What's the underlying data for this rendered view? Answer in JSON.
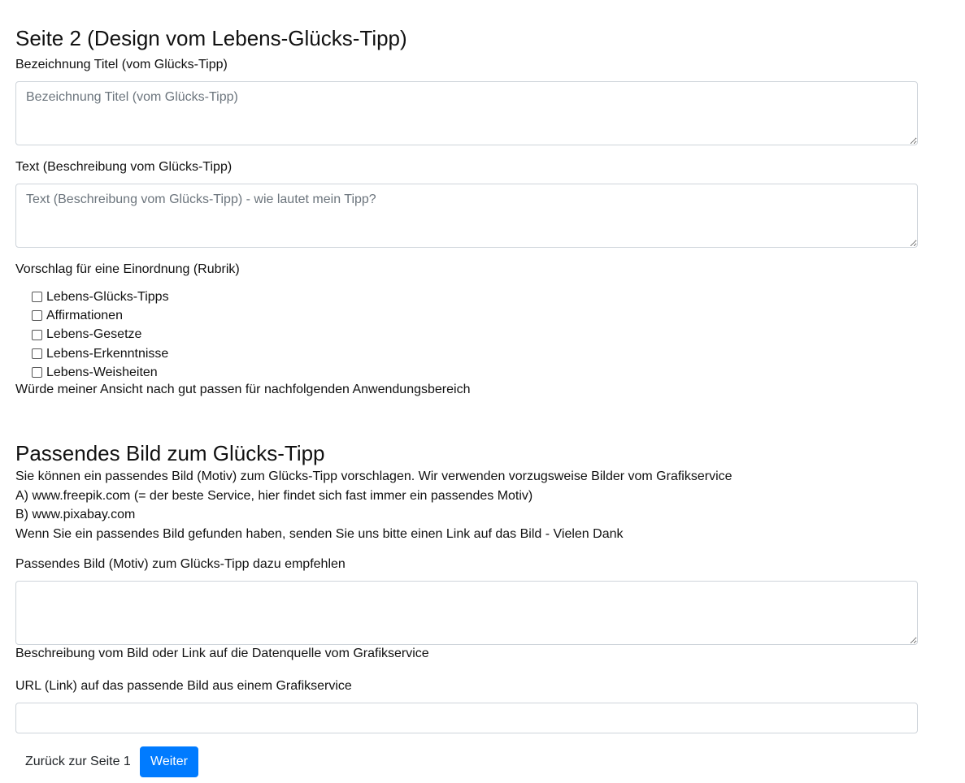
{
  "page": {
    "title": "Seite 2 (Design vom Lebens-Glücks-Tipp)"
  },
  "form": {
    "title_field": {
      "label": "Bezeichnung Titel (vom Glücks-Tipp)",
      "placeholder": "Bezeichnung Titel (vom Glücks-Tipp)",
      "value": ""
    },
    "text_field": {
      "label": "Text (Beschreibung vom Glücks-Tipp)",
      "placeholder": "Text (Beschreibung vom Glücks-Tipp) - wie lautet mein Tipp?",
      "value": ""
    },
    "category": {
      "label": "Vorschlag für eine Einordnung (Rubrik)",
      "options": [
        {
          "label": "Lebens-Glücks-Tipps",
          "checked": false
        },
        {
          "label": "Affirmationen",
          "checked": false
        },
        {
          "label": "Lebens-Gesetze",
          "checked": false
        },
        {
          "label": "Lebens-Erkenntnisse",
          "checked": false
        },
        {
          "label": "Lebens-Weisheiten",
          "checked": false
        }
      ],
      "note": "Würde meiner Ansicht nach gut passen für nachfolgenden Anwendungsbereich"
    }
  },
  "image_section": {
    "heading": "Passendes Bild zum Glücks-Tipp",
    "info_lines": [
      "Sie können ein passendes Bild (Motiv) zum Glücks-Tipp vorschlagen. Wir verwenden vorzugsweise Bilder vom Grafikservice",
      "A) www.freepik.com (= der beste Service, hier findet sich fast immer ein passendes Motiv)",
      "B) www.pixabay.com",
      "Wenn Sie ein passendes Bild gefunden haben, senden Sie uns bitte einen Link auf das Bild - Vielen Dank"
    ],
    "recommend_field": {
      "label": "Passendes Bild (Motiv) zum Glücks-Tipp dazu empfehlen",
      "placeholder": "",
      "value": "",
      "help": "Beschreibung vom Bild oder Link auf die Datenquelle vom Grafikservice"
    },
    "url_field": {
      "label": "URL (Link) auf das passende Bild aus einem Grafikservice",
      "placeholder": "",
      "value": ""
    }
  },
  "actions": {
    "back_label": "Zurück zur Seite 1",
    "next_label": "Weiter",
    "accent_color": "#007bff"
  }
}
